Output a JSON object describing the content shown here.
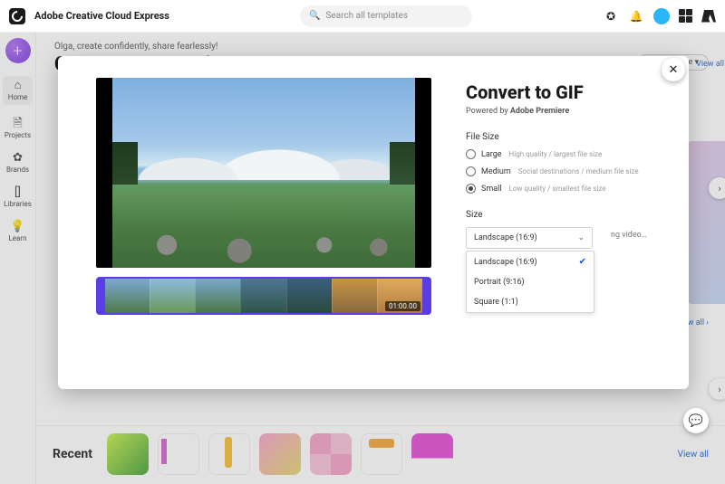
{
  "topbar": {
    "appTitle": "Adobe Creative Cloud Express",
    "searchPlaceholder": "Search all templates"
  },
  "sidebar": {
    "items": [
      {
        "label": "Home"
      },
      {
        "label": "Projects"
      },
      {
        "label": "Brands"
      },
      {
        "label": "Libraries"
      },
      {
        "label": "Learn"
      }
    ]
  },
  "main": {
    "greeting": "Olga, create confidently, share fearlessly!",
    "heading": "Create a new project",
    "customSize": "Custom size",
    "viewAll": "View all  ›",
    "trailingHint": "ng video…"
  },
  "modal": {
    "title": "Convert to GIF",
    "poweredPrefix": "Powered by ",
    "poweredBrand": "Adobe Premiere",
    "fileSizeLabel": "File Size",
    "options": [
      {
        "name": "Large",
        "desc": "High quality / largest file size"
      },
      {
        "name": "Medium",
        "desc": "Social destinations / medium file size"
      },
      {
        "name": "Small",
        "desc": "Low quality / smallest file size"
      }
    ],
    "selectedFileSize": "Small",
    "sizeLabel": "Size",
    "sizeSelected": "Landscape (16:9)",
    "sizeOptions": [
      "Landscape (16:9)",
      "Portrait (9:16)",
      "Square (1:1)"
    ],
    "timecode": "01:00.00"
  },
  "recent": {
    "label": "Recent",
    "viewAll": "View all"
  }
}
